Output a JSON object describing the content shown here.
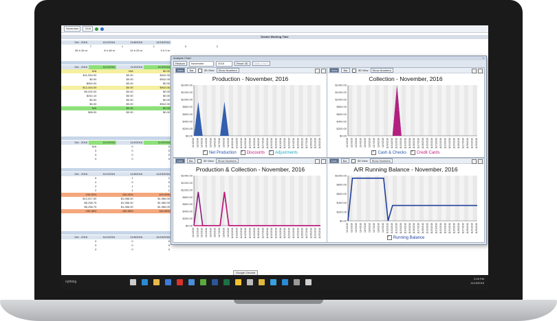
{
  "sheet": {
    "month": "November",
    "year": "2016",
    "title": "Doctor Working Time",
    "header_row": [
      "Oct - 2016",
      "11/1/2016",
      "11/8/2016",
      "11/15/2016",
      "Total - Nov"
    ],
    "row1": [
      "7",
      "1",
      "1",
      "0",
      "2"
    ],
    "row2": [
      "55 h 26 m",
      "8 h 48 m",
      "14 h 25 m",
      "0 h 0 m"
    ],
    "block2_header": [
      "Oct - 2016",
      "11/1/2016",
      "11/2/2016",
      "11/3/2016"
    ],
    "block2_rows": [
      [
        "N/A",
        "N/A",
        "$0.00"
      ],
      [
        "$11,534.00",
        "$0.00",
        "$942.00"
      ],
      [
        "$0.00",
        "$0.00",
        "$942.00"
      ],
      [
        "$900.00",
        "$0.00",
        "$0.00"
      ],
      [
        "$12,434.00",
        "$0.00",
        "$942.00"
      ],
      [
        "$9,252.00",
        "$0.00",
        "$0.00"
      ],
      [
        "$244.10",
        "$0.00",
        "$0.00"
      ],
      [
        "$0.00",
        "$0.00",
        "$0.00"
      ],
      [
        "$0.00",
        "$0.00",
        "$942.00"
      ],
      [
        "N/A",
        "$0.00",
        "$0.00"
      ],
      [
        "$98.00",
        "$0.00",
        "$0.00"
      ]
    ],
    "block3_header": [
      "Oct - 2016",
      "11/1/2016",
      "11/2/2016",
      "11/3/2016"
    ],
    "block3_rows": [
      [
        "N/A",
        "0",
        "0"
      ],
      [
        "0",
        "0",
        "0"
      ],
      [
        "0",
        "0",
        "0"
      ],
      [
        "0",
        "0",
        "0"
      ]
    ],
    "block4_header": [
      "Oct - 2016",
      "11/1/2016",
      "11/8/2016",
      "11/15/2016"
    ],
    "block4_rows": [
      [
        "6",
        "1",
        "1"
      ],
      [
        "4",
        "0",
        "0"
      ],
      [
        "2",
        "1",
        "1"
      ],
      [
        "2",
        "1",
        "1"
      ],
      [
        "100.00%",
        "100.00%",
        "100.00%"
      ],
      [
        "$12,517.50",
        "$1,986.00",
        "$1,986.00"
      ],
      [
        "$6,258.75",
        "$1,986.00",
        "$1,986.00"
      ],
      [
        "$6,258.75",
        "$1,986.00",
        "$1,986.00"
      ],
      [
        "190.38%",
        "182.65%",
        "182.65%"
      ]
    ],
    "block5_header": [
      "Oct - 2016",
      "11/1/2016",
      "11/8/2016",
      "11/15/2016"
    ],
    "block5_rows": [
      [
        "0",
        "0",
        "0"
      ],
      [
        "0",
        "0",
        "0"
      ],
      [
        "0",
        "0",
        "0"
      ]
    ]
  },
  "dialog": {
    "title": "Analysis Chart",
    "restore_label": "Restore",
    "month": "November",
    "year": "2016",
    "reset_label": "Reset 3D",
    "grid_label": "Grid: 1 to 1",
    "close": "×"
  },
  "panels": [
    {
      "tabs": [
        "Area",
        "Bar"
      ],
      "view3d": "3D View",
      "show_numbers": "Show Numbers",
      "title": "Production - November, 2016",
      "yticks": [
        "$1400.00",
        "$1200.00",
        "$1000.00",
        "$800.00",
        "$600.00",
        "$400.00",
        "$200.00",
        "$0.00"
      ],
      "legend": [
        "Net Production",
        "Discounts",
        "Adjustments"
      ]
    },
    {
      "tabs": [
        "Area",
        "Bar"
      ],
      "view3d": "3D View",
      "show_numbers": "Show Numbers",
      "title": "Collection - November, 2016",
      "yticks": [
        "$1400.00",
        "$1200.00",
        "$1000.00",
        "$800.00",
        "$600.00",
        "$400.00",
        "$200.00",
        "$0.00"
      ],
      "legend": [
        "Cash & Checks",
        "Credit Cards"
      ]
    },
    {
      "tabs": [
        "Line",
        "Bar"
      ],
      "view3d": "3D View",
      "show_numbers": "Show Numbers",
      "title": "Production & Collection - November, 2016",
      "yticks": [
        "$1400.00",
        "$1200.00",
        "$1000.00",
        "$800.00",
        "$600.00",
        "$400.00",
        "$200.00",
        "$0.00"
      ],
      "legend": []
    },
    {
      "tabs": [
        "Line",
        "Bar"
      ],
      "view3d": "3D View",
      "show_numbers": "Show Numbers",
      "title": "A/R Running Balance - November, 2016",
      "yticks": [
        "$1000.00",
        "$800.00",
        "$600.00",
        "$400.00",
        "$200.00",
        "$0.00"
      ],
      "legend": [
        "Running Balance"
      ]
    }
  ],
  "chart_data": [
    {
      "type": "area",
      "title": "Production - November, 2016",
      "categories": [
        "11/1",
        "11/2",
        "11/3",
        "11/4",
        "11/5",
        "11/6",
        "11/7",
        "11/8",
        "11/9",
        "11/10",
        "11/11",
        "11/12",
        "11/13",
        "11/14",
        "11/15",
        "11/16",
        "11/17",
        "11/18",
        "11/19",
        "11/20",
        "11/21",
        "11/22",
        "11/23",
        "11/24",
        "11/25",
        "11/26",
        "11/27",
        "11/28",
        "11/29",
        "11/30"
      ],
      "ylim": [
        0,
        1400
      ],
      "series": [
        {
          "name": "Net Production",
          "color": "#1f4fa6",
          "values": [
            0,
            942,
            0,
            0,
            0,
            0,
            0,
            942,
            0,
            0,
            0,
            0,
            0,
            0,
            0,
            0,
            0,
            0,
            0,
            0,
            0,
            0,
            0,
            0,
            0,
            0,
            0,
            0,
            0,
            0
          ]
        },
        {
          "name": "Discounts",
          "color": "#c2187a",
          "values": [
            0,
            0,
            0,
            0,
            0,
            0,
            0,
            0,
            0,
            0,
            0,
            0,
            0,
            0,
            0,
            0,
            0,
            0,
            0,
            0,
            0,
            0,
            0,
            0,
            0,
            0,
            0,
            0,
            0,
            0
          ]
        },
        {
          "name": "Adjustments",
          "color": "#20a8c8",
          "values": [
            0,
            0,
            0,
            0,
            0,
            0,
            0,
            0,
            0,
            0,
            0,
            0,
            0,
            0,
            0,
            0,
            0,
            0,
            0,
            0,
            0,
            0,
            0,
            0,
            0,
            0,
            0,
            0,
            0,
            0
          ]
        }
      ]
    },
    {
      "type": "area",
      "title": "Collection - November, 2016",
      "categories": [
        "11/1",
        "11/2",
        "11/3",
        "11/4",
        "11/5",
        "11/6",
        "11/7",
        "11/8",
        "11/9",
        "11/10",
        "11/11",
        "11/12",
        "11/13",
        "11/14",
        "11/15",
        "11/16",
        "11/17",
        "11/18",
        "11/19",
        "11/20",
        "11/21",
        "11/22",
        "11/23",
        "11/24",
        "11/25",
        "11/26",
        "11/27",
        "11/28",
        "11/29",
        "11/30"
      ],
      "ylim": [
        0,
        1400
      ],
      "series": [
        {
          "name": "Cash & Checks",
          "color": "#1f4fa6",
          "values": [
            0,
            0,
            0,
            0,
            0,
            0,
            0,
            0,
            0,
            0,
            0,
            1400,
            0,
            0,
            0,
            0,
            0,
            0,
            0,
            0,
            0,
            0,
            0,
            0,
            0,
            0,
            0,
            0,
            0,
            0
          ]
        },
        {
          "name": "Credit Cards",
          "color": "#c2187a",
          "values": [
            0,
            0,
            0,
            0,
            0,
            0,
            0,
            0,
            0,
            0,
            0,
            1400,
            0,
            0,
            0,
            0,
            0,
            0,
            0,
            0,
            0,
            0,
            0,
            0,
            0,
            0,
            0,
            0,
            0,
            0
          ]
        }
      ]
    },
    {
      "type": "line",
      "title": "Production & Collection - November, 2016",
      "categories": [
        "11/1",
        "11/2",
        "11/3",
        "11/4",
        "11/5",
        "11/6",
        "11/7",
        "11/8",
        "11/9",
        "11/10",
        "11/11",
        "11/12",
        "11/13",
        "11/14",
        "11/15",
        "11/16",
        "11/17",
        "11/18",
        "11/19",
        "11/20",
        "11/21",
        "11/22",
        "11/23",
        "11/24",
        "11/25",
        "11/26",
        "11/27",
        "11/28",
        "11/29",
        "11/30"
      ],
      "ylim": [
        0,
        1400
      ],
      "series": [
        {
          "color": "#8b1a7a",
          "values": [
            0,
            942,
            0,
            0,
            0,
            0,
            0,
            942,
            0,
            0,
            0,
            0,
            0,
            0,
            0,
            0,
            0,
            0,
            0,
            0,
            0,
            0,
            0,
            0,
            0,
            0,
            0,
            0,
            0,
            0
          ]
        },
        {
          "color": "#c2187a",
          "values": [
            0,
            0,
            0,
            0,
            0,
            0,
            0,
            942,
            0,
            0,
            0,
            0,
            0,
            0,
            0,
            0,
            0,
            0,
            0,
            0,
            0,
            0,
            0,
            0,
            0,
            0,
            0,
            0,
            0,
            0
          ]
        }
      ]
    },
    {
      "type": "line",
      "title": "A/R Running Balance - November, 2016",
      "categories": [
        "11/1",
        "11/2",
        "11/3",
        "11/4",
        "11/5",
        "11/6",
        "11/7",
        "11/8",
        "11/9",
        "11/10",
        "11/11",
        "11/12",
        "11/13",
        "11/14",
        "11/15",
        "11/16",
        "11/17",
        "11/18",
        "11/19",
        "11/20",
        "11/21",
        "11/22",
        "11/23",
        "11/24",
        "11/25",
        "11/26",
        "11/27",
        "11/28",
        "11/29",
        "11/30"
      ],
      "ylim": [
        0,
        1000
      ],
      "series": [
        {
          "name": "Running Balance",
          "color": "#1f3f9c",
          "values": [
            0,
            942,
            942,
            942,
            942,
            942,
            942,
            942,
            942,
            0,
            340,
            340,
            340,
            340,
            340,
            340,
            340,
            340,
            340,
            340,
            340,
            340,
            340,
            340,
            340,
            340,
            340,
            340,
            340,
            340
          ]
        }
      ]
    }
  ],
  "taskbar": {
    "search_text": "nything",
    "tooltip": "Google Chrome",
    "time": "2:09 PM",
    "date": "11/15/2016",
    "icons": [
      {
        "name": "task-view-icon",
        "color": "#cccccc"
      },
      {
        "name": "edge-icon",
        "color": "#2a8ad4"
      },
      {
        "name": "folder-icon",
        "color": "#e8b84a"
      },
      {
        "name": "mail-icon",
        "color": "#3c7bd6"
      },
      {
        "name": "acrobat-icon",
        "color": "#d8322c"
      },
      {
        "name": "store-icon",
        "color": "#4a8fd8"
      },
      {
        "name": "app-icon",
        "color": "#5aaa3c"
      },
      {
        "name": "word-icon",
        "color": "#2b5797"
      },
      {
        "name": "excel-icon",
        "color": "#1d7044"
      },
      {
        "name": "chrome-icon",
        "color": "#f2c12e"
      },
      {
        "name": "settings-icon",
        "color": "#bbbbbb"
      },
      {
        "name": "explorer-icon",
        "color": "#e0b83e"
      },
      {
        "name": "app2-icon",
        "color": "#3aa0e0"
      },
      {
        "name": "app3-icon",
        "color": "#2a8ad4"
      },
      {
        "name": "app4-icon",
        "color": "#9a9a9a"
      },
      {
        "name": "app5-icon",
        "color": "#d0d0d0"
      }
    ]
  }
}
